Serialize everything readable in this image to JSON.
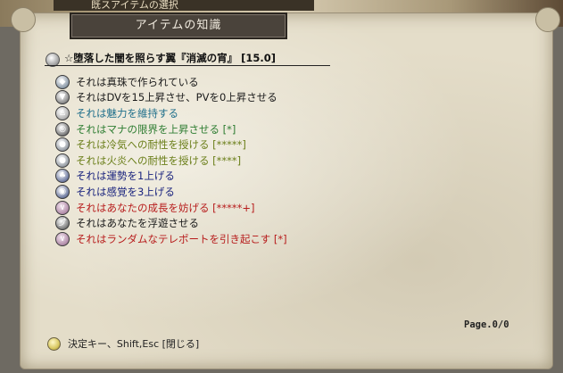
{
  "window": {
    "title": "アイテムの知識",
    "background_title": "既スアイテムの選択"
  },
  "item": {
    "name": "☆堕落した闇を照らす翼『消滅の宵』 [15.0]"
  },
  "properties": [
    {
      "icon": "pearl-material-icon",
      "text": "それは真珠で作られている",
      "color": "#1a1a1a"
    },
    {
      "icon": "dv-pv-icon",
      "text": "それはDVを15上昇させ、PVを0上昇させる",
      "color": "#1a1a1a"
    },
    {
      "icon": "charisma-icon",
      "text": "それは魅力を維持する",
      "color": "#1f6f8b"
    },
    {
      "icon": "mana-icon",
      "text": "それはマナの限界を上昇させる [*]",
      "color": "#2e7d32"
    },
    {
      "icon": "cold-resist-icon",
      "text": "それは冷気への耐性を授ける [*****]",
      "color": "#6b7f1a"
    },
    {
      "icon": "fire-resist-icon",
      "text": "それは火炎への耐性を授ける [****]",
      "color": "#6b7f1a"
    },
    {
      "icon": "luck-icon",
      "text": "それは運勢を1上げる",
      "color": "#1a237e"
    },
    {
      "icon": "perception-icon",
      "text": "それは感覚を3上げる",
      "color": "#1a237e"
    },
    {
      "icon": "growth-hinder-icon",
      "text": "それはあなたの成長を妨げる [*****+]",
      "color": "#b71c1c"
    },
    {
      "icon": "float-icon",
      "text": "それはあなたを浮遊させる",
      "color": "#1a1a1a"
    },
    {
      "icon": "teleport-icon",
      "text": "それはランダムなテレポートを引き起こす [*]",
      "color": "#b71c1c"
    }
  ],
  "footer": {
    "page": "Page.0/0",
    "hint": "決定キー、Shift,Esc [閉じる]"
  }
}
